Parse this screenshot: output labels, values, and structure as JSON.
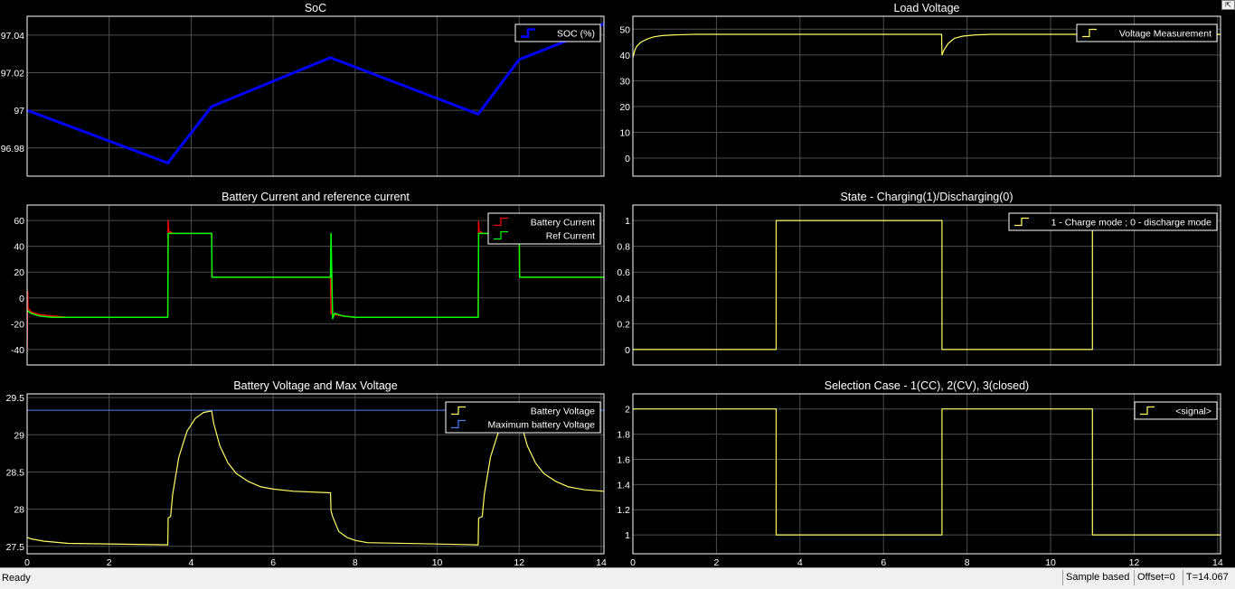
{
  "window": {
    "undock_icon": "undock-arrow-icon"
  },
  "colors": {
    "background": "#000000",
    "axes_bg": "#000000",
    "grid": "#4d4d4d",
    "text": "#ffffff",
    "yellow": "#ffff66",
    "blue": "#0000ff",
    "red": "#ff0000",
    "green": "#00ff00",
    "max_line": "#4d7fff"
  },
  "status": {
    "ready": "Ready",
    "mode": "Sample based",
    "offset": "Offset=0",
    "time": "T=14.067"
  },
  "chart_data": [
    {
      "id": "soc",
      "type": "line",
      "title": "SoC",
      "xlabel": "",
      "ylabel": "",
      "xlim": [
        0,
        14.067
      ],
      "ylim": [
        96.965,
        97.05
      ],
      "xticks": [
        0,
        2,
        4,
        6,
        8,
        10,
        12,
        14
      ],
      "yticks": [
        96.98,
        97,
        97.02,
        97.04
      ],
      "ytick_labels": [
        "96.98",
        "97",
        "97.02",
        "97.04"
      ],
      "show_xtick_labels": false,
      "grid": true,
      "legend_position": "top-right",
      "series": [
        {
          "name": "SOC (%)",
          "color": "#0000ff",
          "width": 3,
          "x": [
            0,
            3.43,
            4.5,
            7.4,
            11.0,
            12.0,
            13.4,
            14.067
          ],
          "y": [
            97.0,
            96.972,
            97.002,
            97.028,
            96.998,
            97.027,
            97.039,
            97.046
          ]
        }
      ]
    },
    {
      "id": "current",
      "type": "line",
      "title": "Battery Current and reference current",
      "xlabel": "",
      "ylabel": "",
      "xlim": [
        0,
        14.067
      ],
      "ylim": [
        -52,
        72
      ],
      "xticks": [
        0,
        2,
        4,
        6,
        8,
        10,
        12,
        14
      ],
      "yticks": [
        -40,
        -20,
        0,
        20,
        40,
        60
      ],
      "ytick_labels": [
        "-40",
        "-20",
        "0",
        "20",
        "40",
        "60"
      ],
      "show_xtick_labels": false,
      "grid": true,
      "legend_position": "top-right",
      "series": [
        {
          "name": "Battery Current",
          "color": "#ff0000",
          "width": 1.5,
          "x": [
            0,
            0.01,
            0.02,
            0.1,
            0.3,
            0.6,
            1.0,
            3.43,
            3.44,
            3.45,
            3.55,
            4.5,
            4.51,
            7.4,
            7.41,
            7.5,
            7.7,
            8.0,
            11.0,
            11.01,
            11.02,
            11.12,
            12.0,
            12.01,
            14.067
          ],
          "y": [
            -40,
            5,
            -8,
            -11,
            -13,
            -14,
            -15,
            -15,
            60,
            52,
            50,
            50,
            16,
            16,
            -12,
            -13,
            -14,
            -15,
            -15,
            59,
            52,
            50,
            50,
            16,
            16
          ]
        },
        {
          "name": "Ref Current",
          "color": "#00ff00",
          "width": 1.5,
          "x": [
            0,
            0.01,
            0.1,
            0.3,
            0.6,
            1.0,
            3.43,
            3.44,
            4.5,
            4.51,
            7.4,
            7.41,
            7.45,
            7.5,
            7.7,
            8.0,
            11.0,
            11.01,
            12.0,
            12.01,
            14.067
          ],
          "y": [
            -10,
            -10,
            -12,
            -14,
            -15,
            -15,
            -15,
            50,
            50,
            16,
            16,
            50,
            -16,
            -12,
            -14,
            -15,
            -15,
            50,
            50,
            16,
            16
          ]
        }
      ]
    },
    {
      "id": "batvolt",
      "type": "line",
      "title": "Battery Voltage and Max Voltage",
      "xlabel": "",
      "ylabel": "",
      "xlim": [
        0,
        14.067
      ],
      "ylim": [
        27.4,
        29.55
      ],
      "xticks": [
        0,
        2,
        4,
        6,
        8,
        10,
        12,
        14
      ],
      "yticks": [
        27.5,
        28,
        28.5,
        29,
        29.5
      ],
      "ytick_labels": [
        "27.5",
        "28",
        "28.5",
        "29",
        "29.5"
      ],
      "show_xtick_labels": true,
      "xtick_labels": [
        "0",
        "2",
        "4",
        "6",
        "8",
        "10",
        "12",
        "14"
      ],
      "grid": true,
      "legend_position": "top-right",
      "series": [
        {
          "name": "Battery Voltage",
          "color": "#ffff66",
          "width": 1.2,
          "x": [
            0,
            0.1,
            0.4,
            1.0,
            3.43,
            3.44,
            3.5,
            3.55,
            3.7,
            3.9,
            4.1,
            4.3,
            4.5,
            4.55,
            4.7,
            4.9,
            5.1,
            5.4,
            5.7,
            6.0,
            6.5,
            7.4,
            7.41,
            7.45,
            7.6,
            7.8,
            8.0,
            8.3,
            11.0,
            11.01,
            11.1,
            11.15,
            11.3,
            11.5,
            11.7,
            12.0,
            12.05,
            12.2,
            12.4,
            12.6,
            12.9,
            13.2,
            13.6,
            14.067
          ],
          "y": [
            27.62,
            27.6,
            27.57,
            27.54,
            27.52,
            27.88,
            27.9,
            28.2,
            28.7,
            29.05,
            29.22,
            29.3,
            29.32,
            29.15,
            28.85,
            28.62,
            28.48,
            28.37,
            28.3,
            28.27,
            28.24,
            28.22,
            27.98,
            27.9,
            27.7,
            27.62,
            27.58,
            27.55,
            27.52,
            27.88,
            27.9,
            28.2,
            28.7,
            29.05,
            29.2,
            29.3,
            29.15,
            28.85,
            28.62,
            28.48,
            28.37,
            28.3,
            28.26,
            28.24
          ]
        },
        {
          "name": "Maximum battery Voltage",
          "color": "#4d7fff",
          "width": 1,
          "x": [
            0,
            14.067
          ],
          "y": [
            29.33,
            29.33
          ]
        }
      ]
    },
    {
      "id": "loadvolt",
      "type": "line",
      "title": "Load Voltage",
      "xlabel": "",
      "ylabel": "",
      "xlim": [
        0,
        14.067
      ],
      "ylim": [
        -7,
        55
      ],
      "xticks": [
        0,
        2,
        4,
        6,
        8,
        10,
        12,
        14
      ],
      "yticks": [
        0,
        10,
        20,
        30,
        40,
        50
      ],
      "ytick_labels": [
        "0",
        "10",
        "20",
        "30",
        "40",
        "50"
      ],
      "show_xtick_labels": false,
      "grid": true,
      "legend_position": "top-right",
      "series": [
        {
          "name": "Voltage Measurement",
          "color": "#ffff66",
          "width": 1.2,
          "x": [
            0,
            0.05,
            0.1,
            0.2,
            0.35,
            0.5,
            0.7,
            1.0,
            1.5,
            3.43,
            4.5,
            7.39,
            7.4,
            7.45,
            7.55,
            7.7,
            7.9,
            8.2,
            8.6,
            11.0,
            12.0,
            14.067
          ],
          "y": [
            39,
            42,
            43.5,
            45,
            46.2,
            47,
            47.5,
            47.8,
            48,
            48,
            48,
            48,
            40,
            42,
            44.5,
            46.5,
            47.3,
            47.8,
            48,
            48,
            48,
            48
          ]
        }
      ]
    },
    {
      "id": "state",
      "type": "line",
      "title": "State - Charging(1)/Discharging(0)",
      "xlabel": "",
      "ylabel": "",
      "xlim": [
        0,
        14.067
      ],
      "ylim": [
        -0.12,
        1.12
      ],
      "xticks": [
        0,
        2,
        4,
        6,
        8,
        10,
        12,
        14
      ],
      "yticks": [
        0,
        0.2,
        0.4,
        0.6,
        0.8,
        1
      ],
      "ytick_labels": [
        "0",
        "0.2",
        "0.4",
        "0.6",
        "0.8",
        "1"
      ],
      "show_xtick_labels": false,
      "grid": true,
      "legend_position": "top-right",
      "series": [
        {
          "name": "1 - Charge mode ; 0 - discharge mode",
          "color": "#ffff66",
          "width": 1.2,
          "x": [
            0,
            3.43,
            3.43,
            7.4,
            7.4,
            11.0,
            11.0
          ],
          "y": [
            0,
            0,
            1,
            1,
            0,
            0,
            1
          ]
        }
      ]
    },
    {
      "id": "selection",
      "type": "line",
      "title": "Selection Case -  1(CC), 2(CV), 3(closed)",
      "xlabel": "",
      "ylabel": "",
      "xlim": [
        0,
        14.067
      ],
      "ylim": [
        0.85,
        2.12
      ],
      "xticks": [
        0,
        2,
        4,
        6,
        8,
        10,
        12,
        14
      ],
      "yticks": [
        1,
        1.2,
        1.4,
        1.6,
        1.8,
        2
      ],
      "ytick_labels": [
        "1",
        "1.2",
        "1.4",
        "1.6",
        "1.8",
        "2"
      ],
      "show_xtick_labels": true,
      "xtick_labels": [
        "0",
        "2",
        "4",
        "6",
        "8",
        "10",
        "12",
        "14"
      ],
      "grid": true,
      "legend_position": "top-right",
      "series": [
        {
          "name": "<signal>",
          "color": "#ffff66",
          "width": 1.2,
          "x": [
            0,
            3.43,
            3.43,
            7.4,
            7.4,
            11.0,
            11.0,
            14.067
          ],
          "y": [
            2,
            2,
            1,
            1,
            2,
            2,
            1,
            1
          ]
        }
      ]
    }
  ]
}
